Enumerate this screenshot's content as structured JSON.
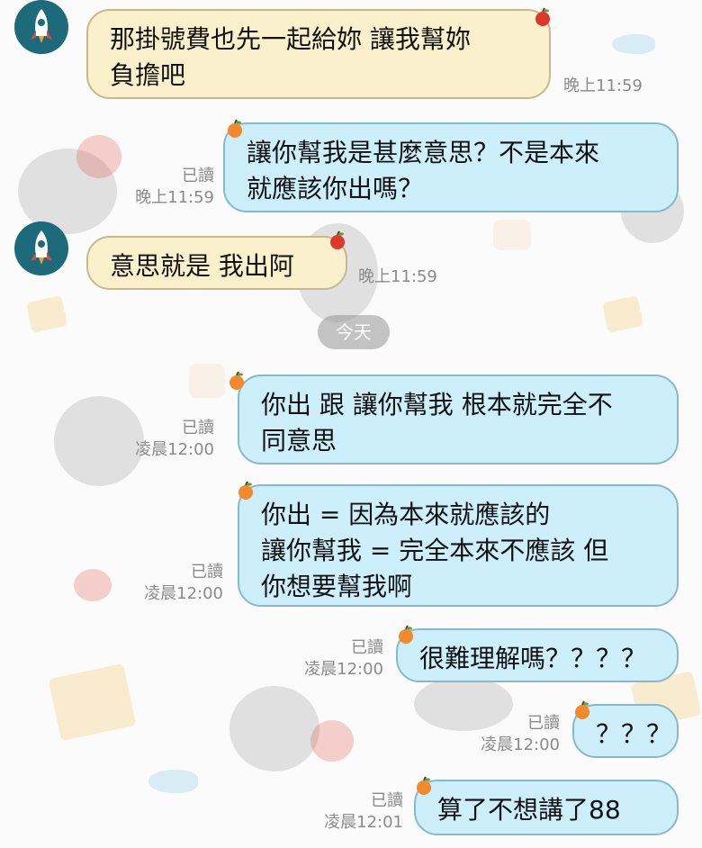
{
  "date_divider": "今天",
  "messages": [
    {
      "side": "left",
      "text": "那掛號費也先一起給妳 讓我幫妳\n負擔吧",
      "time": "晚上11:59",
      "read": ""
    },
    {
      "side": "right",
      "text": "讓你幫我是甚麼意思？不是本來\n就應該你出嗎？",
      "time": "晚上11:59",
      "read": "已讀"
    },
    {
      "side": "left",
      "text": "意思就是 我出阿",
      "time": "晚上11:59",
      "read": ""
    },
    {
      "side": "right",
      "text": "你出 跟 讓你幫我 根本就完全不\n同意思",
      "time": "凌晨12:00",
      "read": "已讀"
    },
    {
      "side": "right",
      "text": "你出 = 因為本來就應該的\n讓你幫我 = 完全本來不應該 但\n你想要幫我啊",
      "time": "凌晨12:00",
      "read": "已讀"
    },
    {
      "side": "right",
      "text": "很難理解嗎？？？？",
      "time": "凌晨12:00",
      "read": "已讀"
    },
    {
      "side": "right",
      "text": "？？？",
      "time": "凌晨12:00",
      "read": "已讀"
    },
    {
      "side": "right",
      "text": "算了不想講了88",
      "time": "凌晨12:01",
      "read": "已讀"
    }
  ],
  "colors": {
    "left_bubble": "#fbf0cc",
    "right_bubble": "#cdeffc",
    "avatar_bg": "#1d6b7a"
  },
  "icons": {
    "avatar": "rocket-icon",
    "bubble_corner": "apple-icon"
  }
}
